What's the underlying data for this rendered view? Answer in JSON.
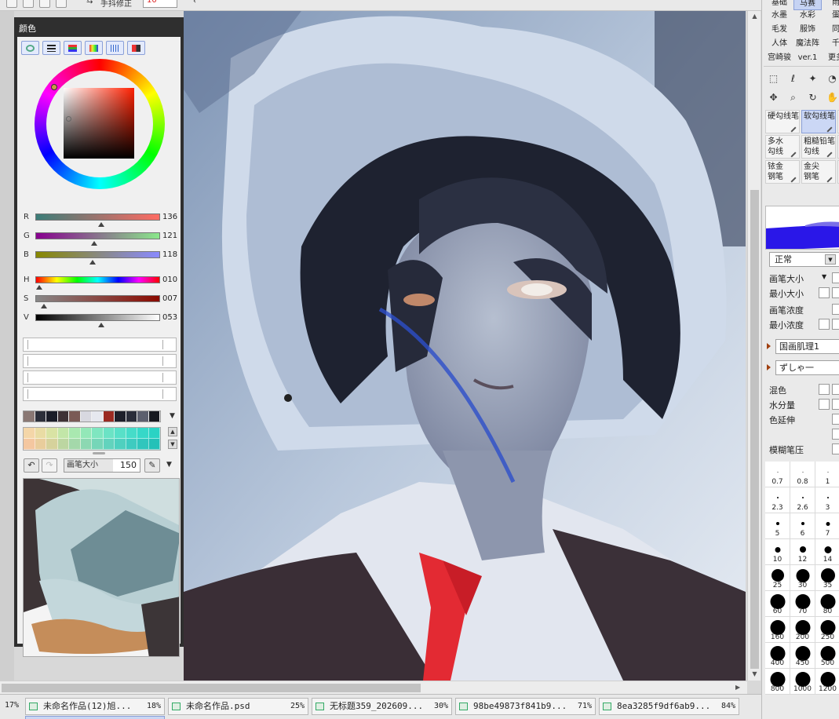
{
  "toolbar": {
    "icons": [
      "new-file-icon",
      "undo-icon",
      "redo-icon",
      "dropdown-icon",
      "stabilizer-icon"
    ],
    "stabilizer_label": "手抖修正",
    "stabilizer_value": "10"
  },
  "color_panel": {
    "title": "颜色",
    "mode_buttons": [
      "wheel-mode-icon",
      "slider-mode-icon",
      "rgb-mode-icon",
      "hsv-mode-icon",
      "histogram-mode-icon",
      "palette-mode-icon"
    ],
    "hue_color": "#ff2000",
    "sliders": [
      {
        "label": "R",
        "value": "136",
        "from": "#3b7d78",
        "to": "#ff6b63",
        "pos": 0.53
      },
      {
        "label": "G",
        "value": "121",
        "from": "#88008f",
        "to": "#8ae88b",
        "pos": 0.47
      },
      {
        "label": "B",
        "value": "118",
        "from": "#888800",
        "to": "#8a8aff",
        "pos": 0.46
      },
      {
        "label": "H",
        "value": "010",
        "from": "rainbow",
        "to": "",
        "pos": 0.03
      },
      {
        "label": "S",
        "value": "007",
        "from": "#888888",
        "to": "#8a0a00",
        "pos": 0.07
      },
      {
        "label": "V",
        "value": "053",
        "from": "#000000",
        "to": "#ffffff",
        "pos": 0.53
      }
    ],
    "swatches": [
      "#8a7874",
      "#2c2f3a",
      "#1a1d28",
      "#3e3236",
      "#7a5a56",
      "#d8d8e0",
      "#e6e8ef",
      "#9b2a22",
      "#1d1f2a",
      "#2a2d3a",
      "#5c5f6e",
      "#16181f"
    ],
    "mixer_brush_label": "画笔大小",
    "mixer_brush_value": "150"
  },
  "right_panel": {
    "categories": [
      [
        "基础",
        "马赛",
        "雨"
      ],
      [
        "水墨",
        "水彩",
        "蛋"
      ],
      [
        "毛发",
        "服饰",
        "同"
      ],
      [
        "人体",
        "魔法阵",
        "千"
      ],
      [
        "宫崎骏",
        "ver.1",
        "更多"
      ]
    ],
    "selected_category": "马赛",
    "tools_row1": [
      "select-rect-icon",
      "lasso-icon",
      "magic-wand-icon",
      "eyedropper-icon"
    ],
    "tools_row2": [
      "move-icon",
      "zoom-icon",
      "rotate-icon",
      "hand-icon"
    ],
    "brushes": [
      {
        "l1": "硬勾线笔",
        "l2": "",
        "sel": false
      },
      {
        "l1": "软勾线笔",
        "l2": "",
        "sel": true
      },
      {
        "l1": "",
        "l2": "",
        "sel": false
      },
      {
        "l1": "多水",
        "l2": "勾线",
        "sel": false
      },
      {
        "l1": "粗糙铅笔",
        "l2": "勾线",
        "sel": false
      },
      {
        "l1": "",
        "l2": "",
        "sel": false
      },
      {
        "l1": "铱金",
        "l2": "钢笔",
        "sel": false
      },
      {
        "l1": "金尖",
        "l2": "钢笔",
        "sel": false
      },
      {
        "l1": "",
        "l2": "",
        "sel": false
      }
    ],
    "blend_mode": "正常",
    "brush_size_label": "画笔大小",
    "min_size_label": "最小大小",
    "brush_density_label": "画笔浓度",
    "min_density_label": "最小浓度",
    "texture_value": "国画肌理1",
    "shape_value": "ずしゃ一",
    "mix_label": "混色",
    "water_label": "水分量",
    "color_extend_label": "色延伸",
    "blur_label": "模糊笔压",
    "sizes": [
      {
        "v": "0.7",
        "d": 1
      },
      {
        "v": "0.8",
        "d": 1
      },
      {
        "v": "1",
        "d": 1
      },
      {
        "v": "2.3",
        "d": 2
      },
      {
        "v": "2.6",
        "d": 2
      },
      {
        "v": "3",
        "d": 2
      },
      {
        "v": "5",
        "d": 4
      },
      {
        "v": "6",
        "d": 4
      },
      {
        "v": "7",
        "d": 5
      },
      {
        "v": "10",
        "d": 7
      },
      {
        "v": "12",
        "d": 8
      },
      {
        "v": "14",
        "d": 9
      },
      {
        "v": "25",
        "d": 16
      },
      {
        "v": "30",
        "d": 17
      },
      {
        "v": "35",
        "d": 18
      },
      {
        "v": "60",
        "d": 19
      },
      {
        "v": "70",
        "d": 19
      },
      {
        "v": "80",
        "d": 19
      },
      {
        "v": "160",
        "d": 19
      },
      {
        "v": "200",
        "d": 19
      },
      {
        "v": "250",
        "d": 19
      },
      {
        "v": "400",
        "d": 19
      },
      {
        "v": "450",
        "d": 19
      },
      {
        "v": "500",
        "d": 19
      },
      {
        "v": "800",
        "d": 19
      },
      {
        "v": "1000",
        "d": 19
      },
      {
        "v": "1200",
        "d": 19
      }
    ]
  },
  "zoom": "17%",
  "tabs": [
    {
      "name": "未命名作品(12)旭...",
      "pct": "18%"
    },
    {
      "name": "未命名作品.psd",
      "pct": "25%"
    },
    {
      "name": "无标题359_202609...",
      "pct": "30%"
    },
    {
      "name": "98be49873f841b9...",
      "pct": "71%"
    },
    {
      "name": "8ea3285f9df6ab9...",
      "pct": "84%"
    }
  ]
}
